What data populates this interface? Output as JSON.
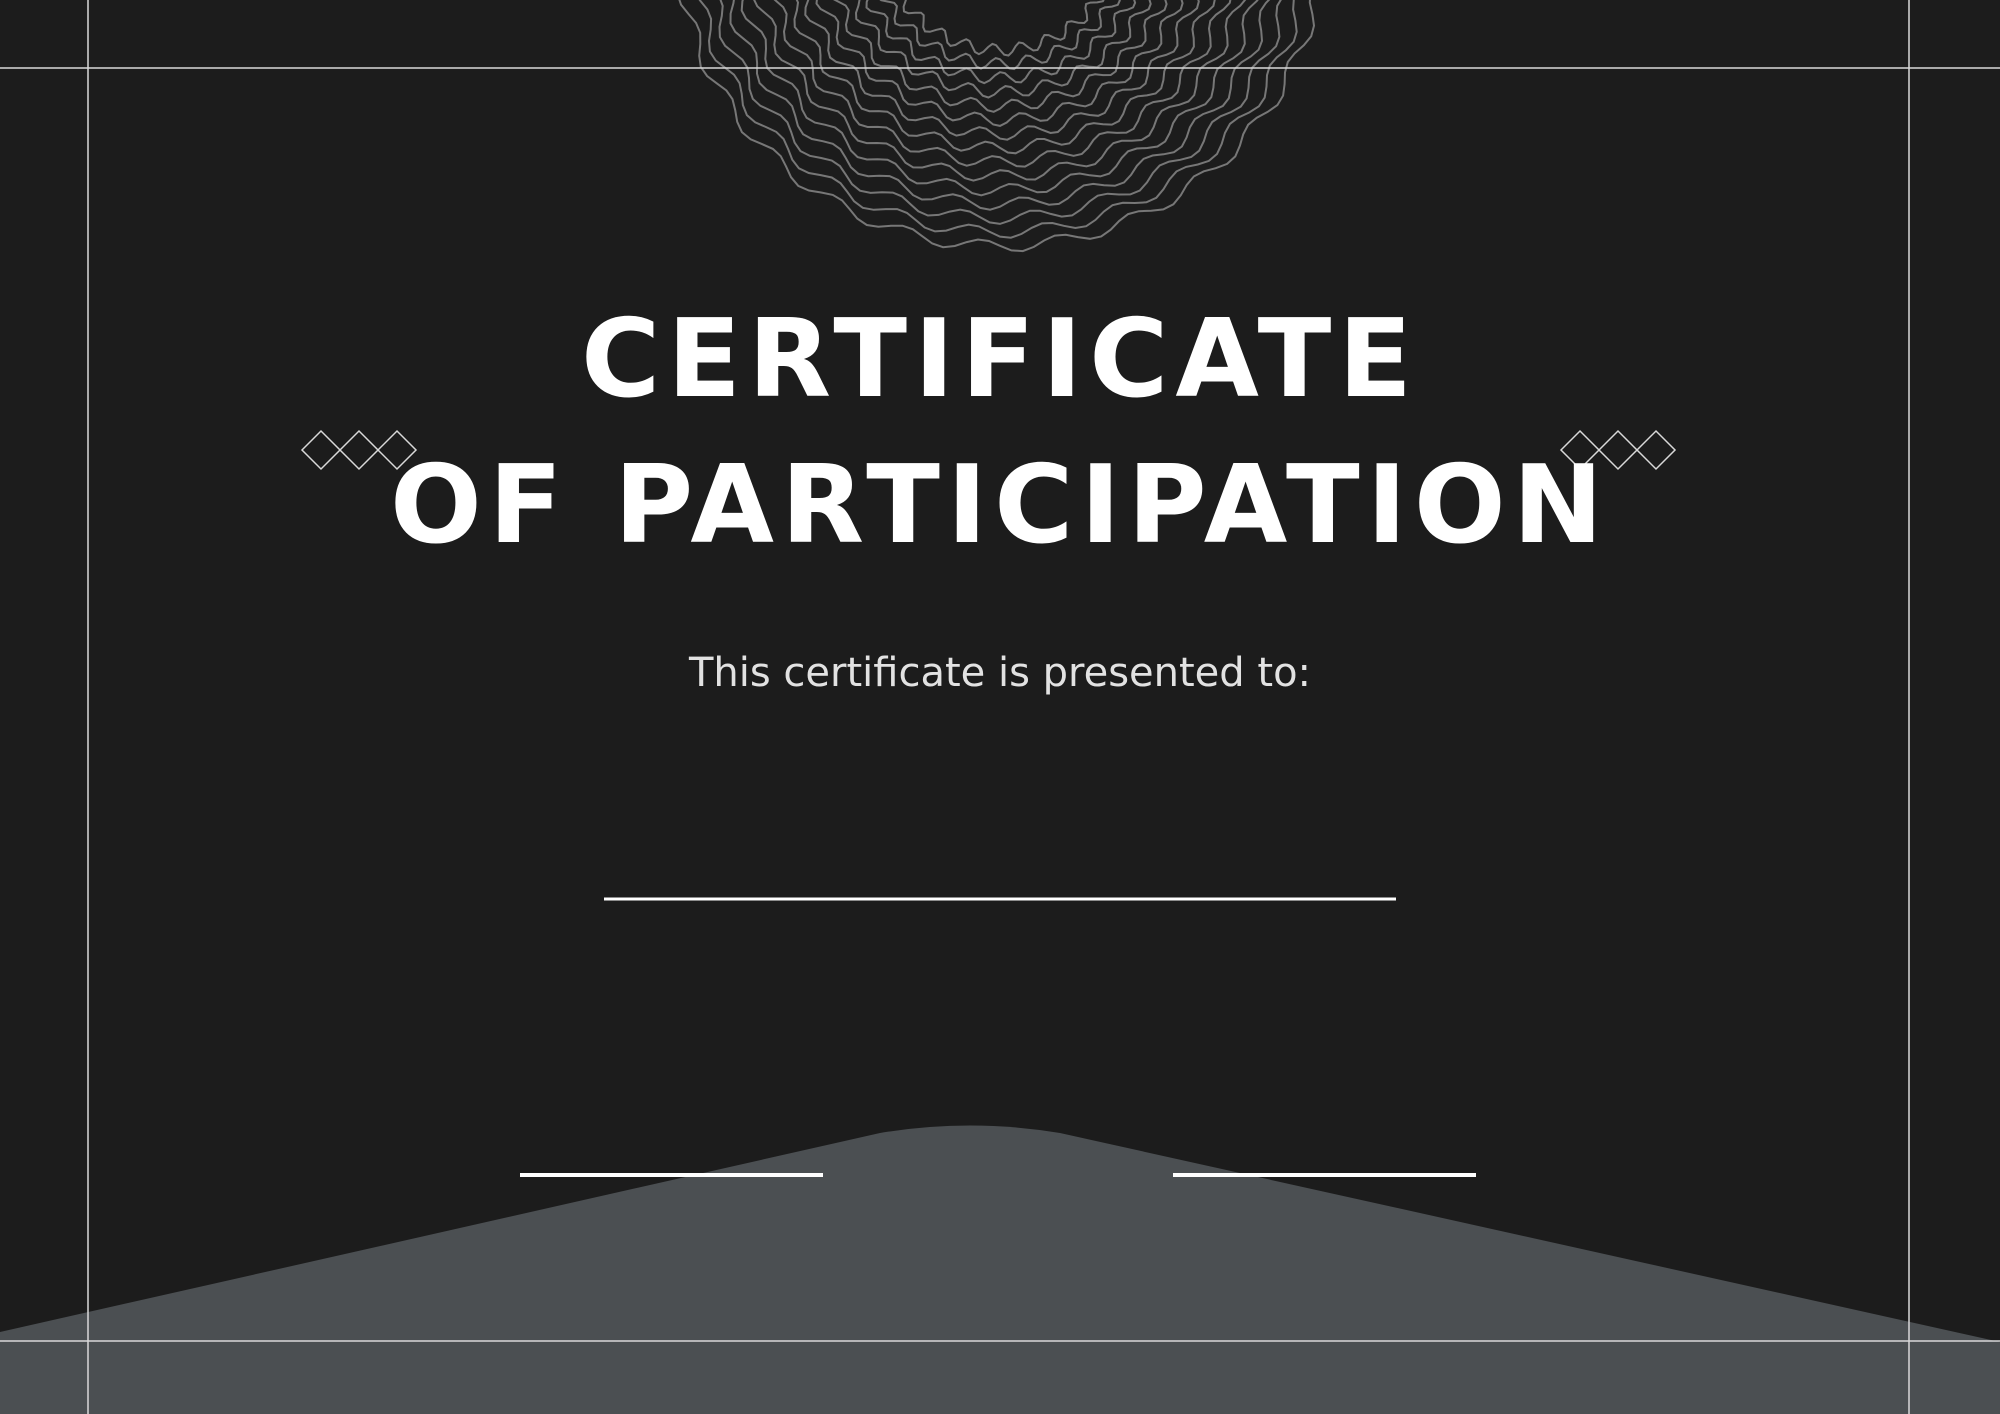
{
  "certificate": {
    "title_line_1": "CERTIFICATE",
    "title_line_2": "OF PARTICIPATION",
    "subtitle": "This certificate is presented to:"
  },
  "decorations": {
    "wave_pattern": "wavy-circle-pattern",
    "diamond_ornament": "diamond-ornament-icon",
    "bottom_mound": "gray-mound-shape"
  },
  "colors": {
    "background": "#1c1c1c",
    "mound": "#4b4f52",
    "text": "#ffffff",
    "subtitle": "#e2e2e2",
    "frame_line": "#d9d9d9",
    "pattern": "#777777"
  }
}
